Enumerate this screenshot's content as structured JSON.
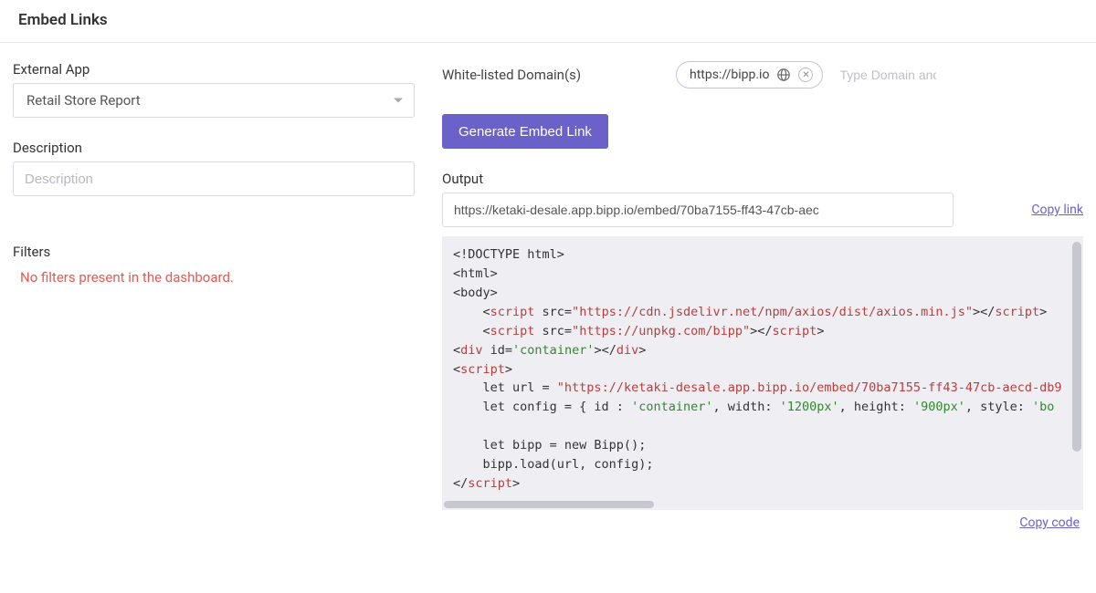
{
  "header": {
    "title": "Embed Links"
  },
  "left": {
    "external_app_label": "External App",
    "external_app_value": "Retail Store Report",
    "description_label": "Description",
    "description_placeholder": "Description",
    "description_value": "",
    "filters_label": "Filters",
    "no_filters_text": "No filters present in the dashboard."
  },
  "right": {
    "domains_label": "White-listed Domain(s)",
    "domain_chip": "https://bipp.io",
    "domain_input_placeholder": "Type Domain and Enter",
    "generate_button": "Generate Embed Link",
    "output_label": "Output",
    "output_value": "https://ketaki-desale.app.bipp.io/embed/70ba7155-ff43-47cb-aec",
    "copy_link": "Copy link",
    "copy_code": "Copy code",
    "code": {
      "l1a": "<!DOCTYPE html>",
      "l2": "<html>",
      "l3": "<body>",
      "l4a": "    <",
      "l4b": "script",
      "l4c": " src=",
      "l4d": "\"https://cdn.jsdelivr.net/npm/axios/dist/axios.min.js\"",
      "l4e": "></",
      "l4f": "script",
      "l4g": ">",
      "l5a": "    <",
      "l5b": "script",
      "l5c": " src=",
      "l5d": "\"https://unpkg.com/bipp\"",
      "l5e": "></",
      "l5f": "script",
      "l5g": ">",
      "l6a": "<",
      "l6b": "div",
      "l6c": " id=",
      "l6d": "'container'",
      "l6e": "></",
      "l6f": "div",
      "l6g": ">",
      "l7a": "<",
      "l7b": "script",
      "l7c": ">",
      "l8a": "    let url = ",
      "l8b": "\"https://ketaki-desale.app.bipp.io/embed/70ba7155-ff43-47cb-aecd-db9",
      "l9a": "    let config = { id : ",
      "l9b": "'container'",
      "l9c": ", width: ",
      "l9d": "'1200px'",
      "l9e": ", height: ",
      "l9f": "'900px'",
      "l9g": ", style: ",
      "l9h": "'bo",
      "l10": " ",
      "l11": "    let bipp = new Bipp();",
      "l12": "    bipp.load(url, config);",
      "l13a": "</",
      "l13b": "script",
      "l13c": ">"
    }
  }
}
